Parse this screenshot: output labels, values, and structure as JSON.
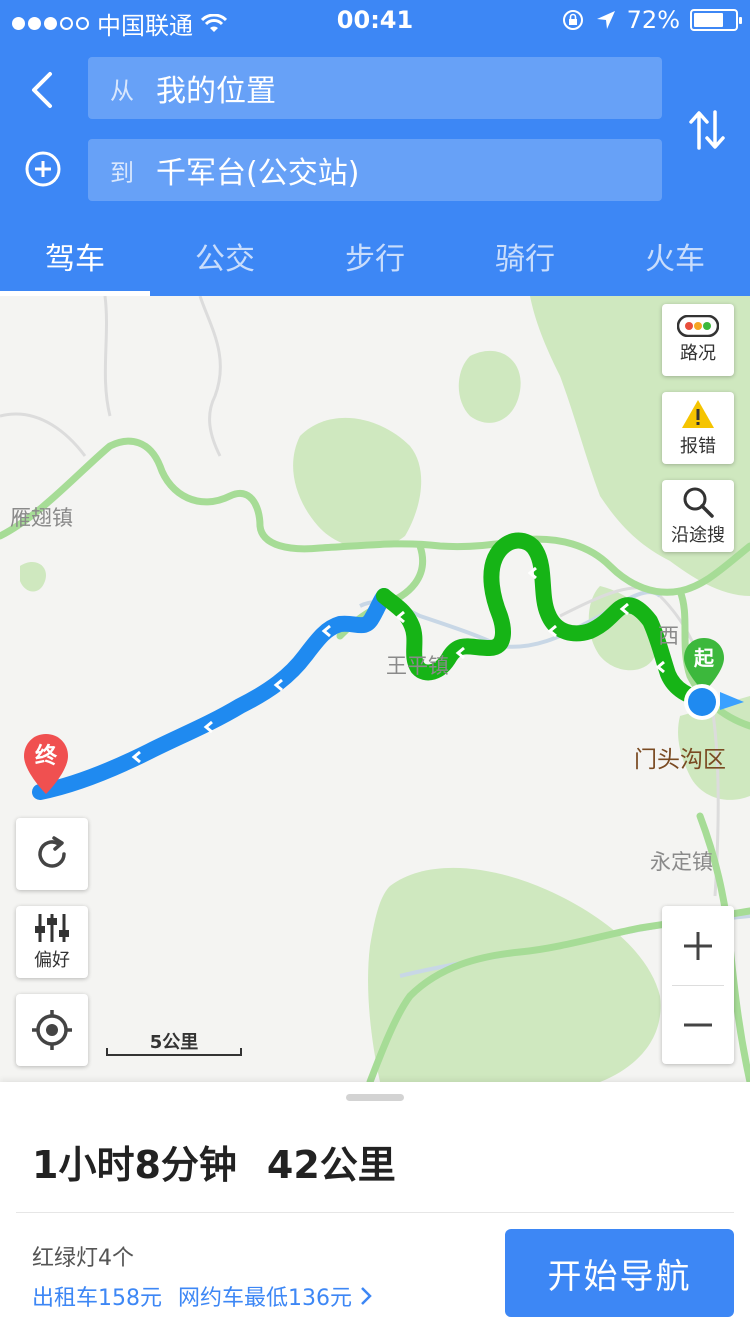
{
  "status_bar": {
    "carrier": "中国联通",
    "time": "00:41",
    "battery_text": "72%",
    "battery_level": 0.72,
    "signal_bars_filled": 3,
    "signal_bars_total": 5
  },
  "route": {
    "from_prefix": "从",
    "from_value": "我的位置",
    "to_prefix": "到",
    "to_value": "千军台(公交站)"
  },
  "tabs": [
    {
      "label": "驾车",
      "active": true
    },
    {
      "label": "公交",
      "active": false
    },
    {
      "label": "步行",
      "active": false
    },
    {
      "label": "骑行",
      "active": false
    },
    {
      "label": "火车",
      "active": false
    }
  ],
  "map": {
    "places": {
      "yanchi": "雁翅镇",
      "wangping": "王平镇",
      "mentougou": "门头沟区",
      "yongding": "永定镇",
      "xi": "西"
    },
    "start_marker": "起",
    "end_marker": "终",
    "scale": "5公里",
    "controls": {
      "traffic": "路况",
      "report": "报错",
      "search_along": "沿途搜",
      "preference": "偏好"
    },
    "colors": {
      "route_blue": "#1f8af0",
      "route_green": "#16b416",
      "end_marker": "#f05050",
      "start_marker": "#3cb83c",
      "greenland": "#cfe8bf"
    }
  },
  "summary": {
    "duration": "1小时8分钟",
    "distance": "42公里",
    "traffic_lights": "红绿灯4个",
    "taxi": "出租车158元",
    "ride_hailing": "网约车最低136元",
    "start_button": "开始导航"
  }
}
